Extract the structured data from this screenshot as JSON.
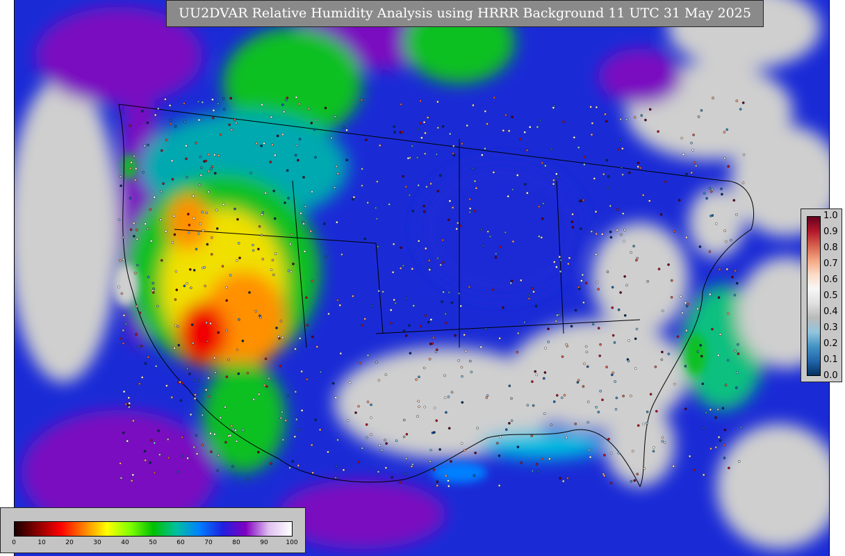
{
  "title": "UU2DVAR Relative Humidity Analysis using HRRR Background 11 UTC 31 May 2025",
  "main_colorbar": {
    "ticks": [
      "0",
      "10",
      "20",
      "30",
      "40",
      "50",
      "60",
      "70",
      "80",
      "90",
      "100"
    ],
    "colors": [
      "#1a0000",
      "#8a0000",
      "#ff0000",
      "#ff8000",
      "#ffff00",
      "#80ff00",
      "#00c000",
      "#00c0a0",
      "#0080ff",
      "#2020e0",
      "#8000c0",
      "#e0c0f0",
      "#ffffff"
    ]
  },
  "obs_colorbar": {
    "ticks": [
      "1.0",
      "0.9",
      "0.8",
      "0.7",
      "0.6",
      "0.5",
      "0.4",
      "0.3",
      "0.2",
      "0.1",
      "0.0"
    ],
    "colors": [
      "#67001f",
      "#b2182b",
      "#d6604d",
      "#f4a582",
      "#fddbc7",
      "#f7f7f7",
      "#e0e0e0",
      "#bababa",
      "#92c5de",
      "#4393c3",
      "#2166ac",
      "#053061"
    ]
  },
  "legend": {
    "humid_gray": "#cfcfcf",
    "moist_blue": "#1a2bd6",
    "purple": "#7a10c0",
    "green": "#10c020",
    "yellow": "#f0e000",
    "red": "#f00000"
  }
}
